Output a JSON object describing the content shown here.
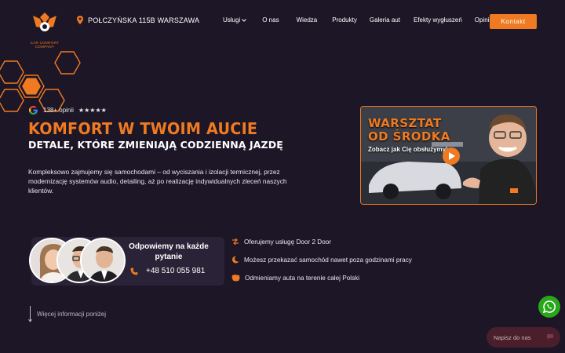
{
  "header": {
    "logo_alt_text": "CAR COMFORT COMPANY",
    "address": "POŁCZYŃSKA 115B WARSZAWA",
    "nav": [
      {
        "label": "Usługi",
        "has_dropdown": true
      },
      {
        "label": "O nas"
      },
      {
        "label": "Wiedza"
      },
      {
        "label": "Produkty"
      },
      {
        "label": "Galeria aut"
      },
      {
        "label": "Efekty wygłuszeń"
      },
      {
        "label": "Opinie"
      }
    ],
    "cta_label": "Kontakt"
  },
  "hero": {
    "rating_text": "138+ opinii",
    "rating_stars": "★★★★★",
    "title": "KOMFORT W TWOIM AUCIE",
    "subtitle": "DETALE, KTÓRE ZMIENIAJĄ CODZIENNĄ JAZDĘ",
    "description": "Kompleksowo zajmujemy się samochodami – od wyciszania i izolacji termicznej, przez modernizację systemów audio, detailing, aż po realizację indywidualnych zleceń naszych klientów."
  },
  "video": {
    "title_line1": "WARSZTAT",
    "title_line2": "OD ŚRODKA",
    "subtitle": "Zobacz jak Cię obsłużymy!"
  },
  "contact": {
    "title": "Odpowiemy na każde pytanie",
    "phone": "+48 510 055 981"
  },
  "features": [
    {
      "icon": "door-to-door-icon",
      "text": "Oferujemy usługę Door 2 Door"
    },
    {
      "icon": "moon-icon",
      "text": "Możesz przekazać samochód nawet poza godzinami pracy"
    },
    {
      "icon": "poland-map-icon",
      "text": "Odmieniamy auta na terenie całej Polski"
    }
  ],
  "more_info": "Więcej informacji poniżej",
  "chat": {
    "placeholder": "Napisz do nas"
  },
  "colors": {
    "accent": "#f07a21",
    "background": "#1c1627",
    "card": "#2a2236",
    "whatsapp": "#29a71a",
    "chat": "#4a1f2b"
  }
}
